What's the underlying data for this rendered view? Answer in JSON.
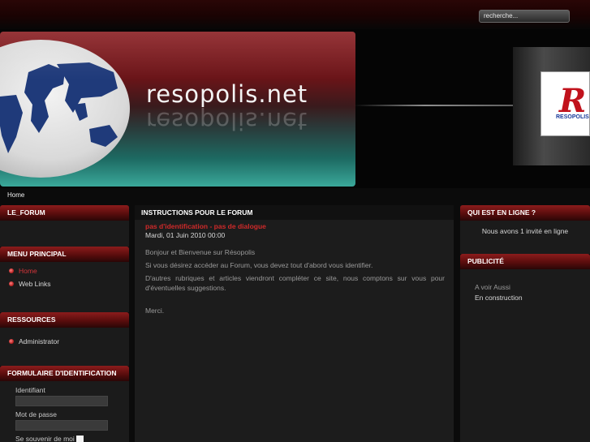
{
  "search": {
    "placeholder": "recherche..."
  },
  "header": {
    "site_title": "resopolis.net",
    "logo_letter": "R",
    "logo_text": "RESOPOLIS"
  },
  "breadcrumb": {
    "home": "Home"
  },
  "left": {
    "le_forum": {
      "title": "LE_FORUM"
    },
    "menu": {
      "title": "MENU PRINCIPAL",
      "items": [
        {
          "label": "Home",
          "active": true
        },
        {
          "label": "Web Links",
          "active": false
        }
      ]
    },
    "ressources": {
      "title": "RESSOURCES",
      "items": [
        {
          "label": "Administrator"
        }
      ]
    },
    "login": {
      "title": "FORMULAIRE D'IDENTIFICATION",
      "username_label": "Identifiant",
      "password_label": "Mot de passe",
      "remember_label": "Se souvenir de moi"
    }
  },
  "main": {
    "title": "INSTRUCTIONS POUR LE FORUM",
    "article_title": "pas d'identification - pas de dialogue",
    "date": "Mardi, 01 Juin 2010 00:00",
    "paragraphs": [
      "Bonjour et Bienvenue sur Résopolis",
      "Si vous désirez accéder au Forum, vous devez tout d'abord vous identifier.",
      "D'autres rubriques et articles viendront compléter ce site, nous comptons sur vous pour d'éventuelles suggestions.",
      "Merci."
    ]
  },
  "right": {
    "online": {
      "title": "QUI EST EN LIGNE ?",
      "text": "Nous avons 1 invité en ligne"
    },
    "pub": {
      "title": "PUBLICITÉ",
      "line1": "A voir Aussi",
      "line2": "En construction"
    }
  }
}
